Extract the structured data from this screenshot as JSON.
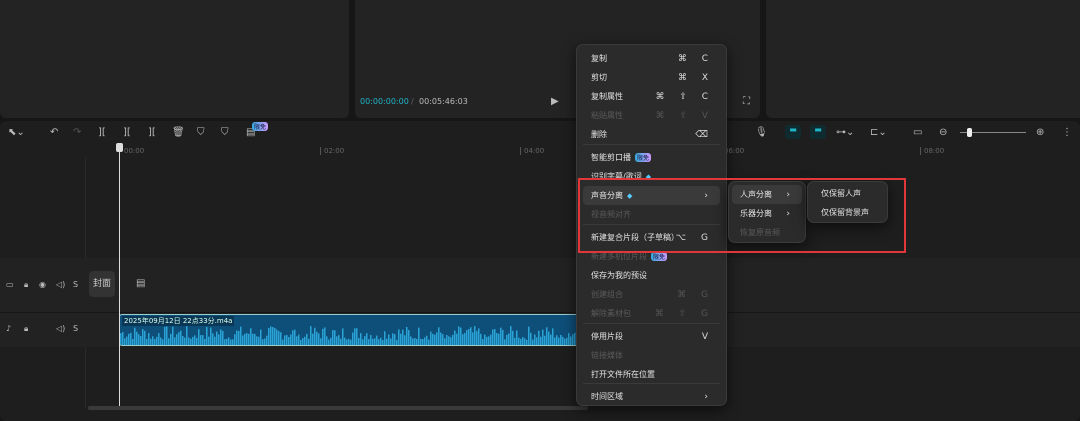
{
  "player": {
    "current_time": "00:00:00:00",
    "separator": "/",
    "total_time": "00:05:46:03"
  },
  "toolbar": {
    "badge": "限免"
  },
  "ruler": {
    "labels": [
      "00:00",
      "02:00",
      "04:00",
      "06:00",
      "08:00"
    ]
  },
  "tracks": {
    "cover_label": "封面",
    "audio_clip_name": "2025年09月12日 22点33分.m4a"
  },
  "context_menu": {
    "items": [
      {
        "label": "复制",
        "shortcut": "⌘ C",
        "disabled": false
      },
      {
        "label": "剪切",
        "shortcut": "⌘ X",
        "disabled": false
      },
      {
        "label": "复制属性",
        "shortcut": "⌘ ⇧ C",
        "disabled": false
      },
      {
        "label": "粘贴属性",
        "shortcut": "⌘ ⇧ V",
        "disabled": true
      },
      {
        "label": "删除",
        "shortcut": "⌫",
        "disabled": false
      },
      {
        "label": "智能剪口播",
        "badge": "限免",
        "disabled": false
      },
      {
        "label": "识别字幕/歌词",
        "disabled": false
      },
      {
        "label": "声音分离",
        "shortcut": "›",
        "disabled": false
      },
      {
        "label": "视音频对齐",
        "disabled": true
      },
      {
        "label": "新建复合片段（子草稿）",
        "shortcut": "⌥ G",
        "disabled": false
      },
      {
        "label": "新建多机位片段",
        "badge": "限免",
        "disabled": true
      },
      {
        "label": "保存为我的预设",
        "disabled": false
      },
      {
        "label": "创建组合",
        "shortcut": "⌘ G",
        "disabled": true
      },
      {
        "label": "解除素材包",
        "shortcut": "⌘ ⇧ G",
        "disabled": true
      },
      {
        "label": "停用片段",
        "shortcut": "V",
        "disabled": false
      },
      {
        "label": "链接媒体",
        "disabled": true
      },
      {
        "label": "打开文件所在位置",
        "disabled": false
      },
      {
        "label": "时间区域",
        "shortcut": "›",
        "disabled": false
      }
    ]
  },
  "submenu": {
    "items": [
      {
        "label": "人声分离",
        "arrow": "›"
      },
      {
        "label": "乐器分离",
        "arrow": "›"
      },
      {
        "label": "恢复原音频"
      }
    ]
  },
  "submenu2": {
    "items": [
      {
        "label": "仅保留人声"
      },
      {
        "label": "仅保留背景声"
      }
    ]
  },
  "colors": {
    "accent": "#1fb5c9",
    "highlight_box": "#e0383a",
    "clip": "#0e5a8a"
  }
}
